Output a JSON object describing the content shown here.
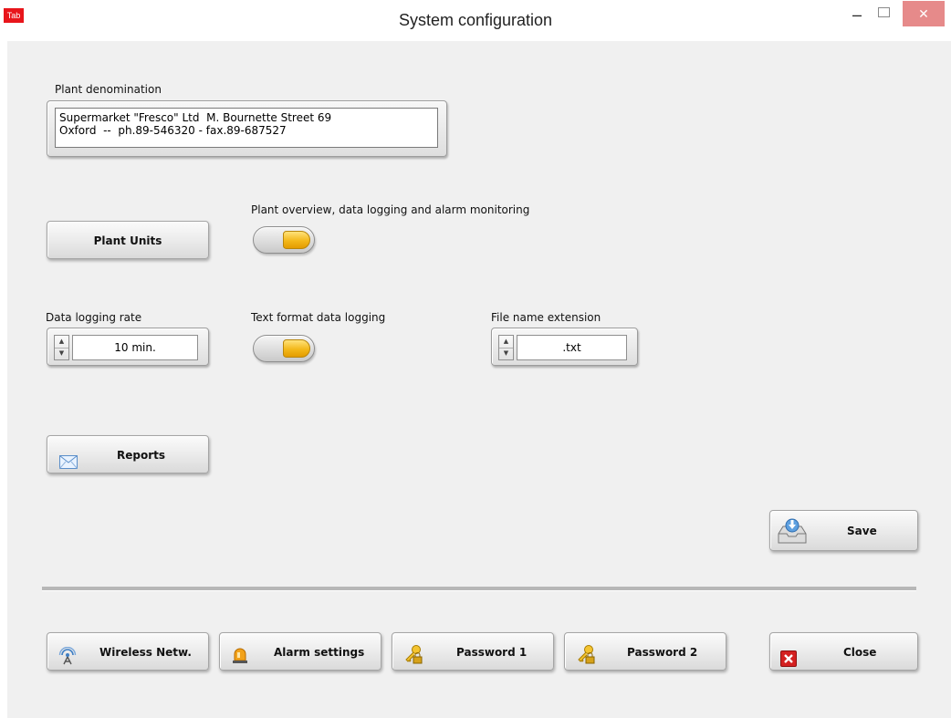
{
  "window": {
    "app_icon_text": "Tab",
    "title": "System configuration",
    "minimize_glyph": "–",
    "close_glyph": "✕"
  },
  "plant_denomination": {
    "label": "Plant denomination",
    "lines": [
      "Supermarket \"Fresco\" Ltd  M. Bournette Street 69",
      "Oxford  --  ph.89-546320 - fax.89-687527"
    ]
  },
  "plant_units": {
    "button_label": "Plant Units"
  },
  "plant_overview": {
    "label": "Plant overview, data logging and alarm monitoring",
    "toggle_state": "on"
  },
  "data_logging_rate": {
    "label": "Data logging rate",
    "value": "10 min."
  },
  "text_format_logging": {
    "label": "Text format data logging",
    "toggle_state": "on"
  },
  "file_name_extension": {
    "label": "File name extension",
    "value": ".txt"
  },
  "reports": {
    "button_label": "Reports",
    "icon": "envelope-icon"
  },
  "save": {
    "button_label": "Save",
    "icon": "save-tray-icon"
  },
  "bottom_buttons": [
    {
      "label": "Wireless Netw.",
      "icon": "antenna-icon"
    },
    {
      "label": "Alarm settings",
      "icon": "alarm-beacon-icon"
    },
    {
      "label": "Password 1",
      "icon": "key-lock-icon"
    },
    {
      "label": "Password 2",
      "icon": "key-lock-icon"
    }
  ],
  "close": {
    "button_label": "Close",
    "icon": "close-x-icon"
  },
  "colors": {
    "toggle_on": "#f3b81a",
    "close_red": "#d42020",
    "panel_bg": "#f0f0f0"
  }
}
